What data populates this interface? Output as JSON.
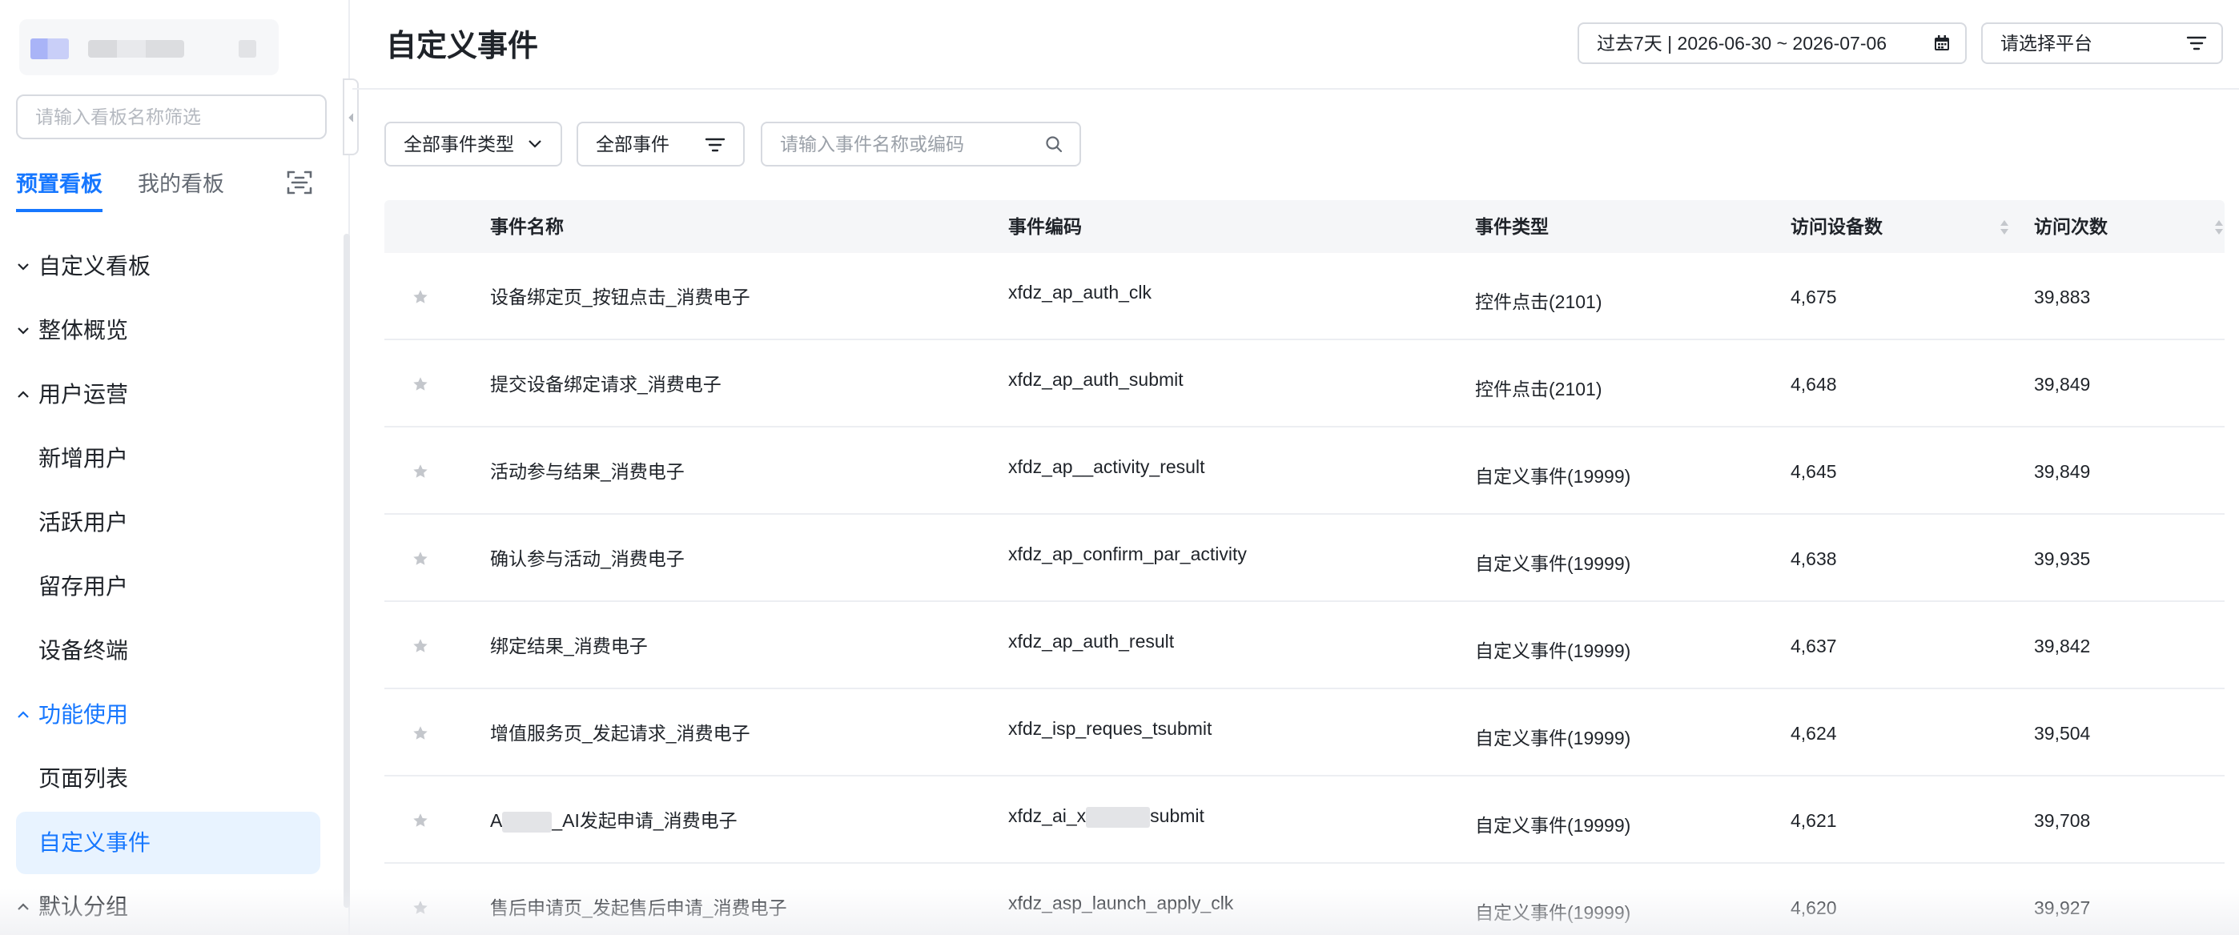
{
  "sidebar": {
    "search_placeholder": "请输入看板名称筛选",
    "tabs": [
      {
        "label": "预置看板",
        "active": true
      },
      {
        "label": "我的看板",
        "active": false
      }
    ],
    "nav": [
      {
        "label": "自定义看板",
        "kind": "group",
        "expanded": false
      },
      {
        "label": "整体概览",
        "kind": "group",
        "expanded": false
      },
      {
        "label": "用户运营",
        "kind": "group",
        "expanded": true
      },
      {
        "label": "新增用户",
        "kind": "child"
      },
      {
        "label": "活跃用户",
        "kind": "child"
      },
      {
        "label": "留存用户",
        "kind": "child"
      },
      {
        "label": "设备终端",
        "kind": "child"
      },
      {
        "label": "功能使用",
        "kind": "group",
        "expanded": true,
        "active": true
      },
      {
        "label": "页面列表",
        "kind": "child"
      },
      {
        "label": "自定义事件",
        "kind": "child",
        "selected": true
      },
      {
        "label": "默认分组",
        "kind": "group",
        "expanded": true
      }
    ]
  },
  "header": {
    "title": "自定义事件",
    "date_range": "过去7天 | 2026-06-30 ~ 2026-07-06",
    "platform_placeholder": "请选择平台"
  },
  "filters": {
    "event_type_label": "全部事件类型",
    "event_scope_label": "全部事件",
    "search_placeholder": "请输入事件名称或编码"
  },
  "table": {
    "columns": [
      "事件名称",
      "事件编码",
      "事件类型",
      "访问设备数",
      "访问次数"
    ],
    "rows": [
      {
        "name": "设备绑定页_按钮点击_消费电子",
        "code": "xfdz_ap_auth_clk",
        "type": "控件点击(2101)",
        "devices": "4,675",
        "visits": "39,883"
      },
      {
        "name": "提交设备绑定请求_消费电子",
        "code": "xfdz_ap_auth_submit",
        "type": "控件点击(2101)",
        "devices": "4,648",
        "visits": "39,849"
      },
      {
        "name": "活动参与结果_消费电子",
        "code": "xfdz_ap__activity_result",
        "type": "自定义事件(19999)",
        "devices": "4,645",
        "visits": "39,849"
      },
      {
        "name": "确认参与活动_消费电子",
        "code": "xfdz_ap_confirm_par_activity",
        "type": "自定义事件(19999)",
        "devices": "4,638",
        "visits": "39,935"
      },
      {
        "name": "绑定结果_消费电子",
        "code": "xfdz_ap_auth_result",
        "type": "自定义事件(19999)",
        "devices": "4,637",
        "visits": "39,842"
      },
      {
        "name": "增值服务页_发起请求_消费电子",
        "code": "xfdz_isp_reques_tsubmit",
        "type": "自定义事件(19999)",
        "devices": "4,624",
        "visits": "39,504"
      },
      {
        "name_prefix": "A",
        "name_suffix": "_AI发起申请_消费电子",
        "code_prefix": "xfdz_ai_x",
        "code_suffix": "submit",
        "type": "自定义事件(19999)",
        "devices": "4,621",
        "visits": "39,708"
      },
      {
        "name": "售后申请页_发起售后申请_消费电子",
        "code": "xfdz_asp_launch_apply_clk",
        "type": "自定义事件(19999)",
        "devices": "4,620",
        "visits": "39,927"
      }
    ]
  },
  "colors": {
    "accent": "#1677ff",
    "selected_bg": "#e8f3ff",
    "border": "#d7dae0",
    "star": "#c4c7cc"
  },
  "icons": {
    "scan": "scan-icon",
    "calendar": "calendar-icon",
    "filter": "filter-lines-icon",
    "search": "search-icon",
    "star": "star-icon",
    "sort": "sort-icon",
    "chevron": "chevron-icon"
  }
}
